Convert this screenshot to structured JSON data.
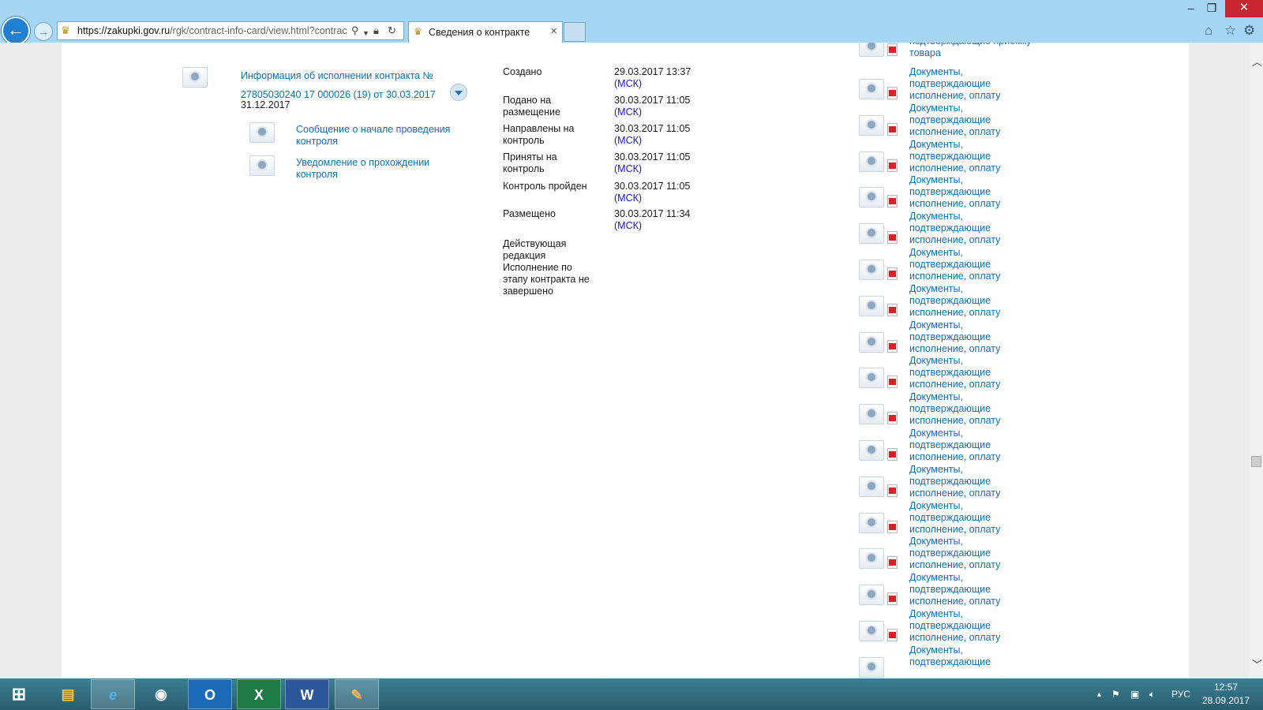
{
  "browser": {
    "url_host": "https://zakupki.gov.ru",
    "url_path": "/rgk/contract-info-card/view.html?contrac",
    "tab_title": "Сведения о контракте",
    "tab_close": "×",
    "window_controls": {
      "minimize": "–",
      "restore": "❐",
      "close": "✕"
    },
    "toolbar_icons": [
      "home-icon",
      "favorites-star-icon",
      "settings-gear-icon"
    ]
  },
  "contract": {
    "info_link": "Информация об исполнении контракта № 27805030240 17 000026 (19) от 30.03.2017",
    "info_date": "31.12.2017",
    "sub_docs": [
      {
        "label": "Сообщение о начале проведения контроля"
      },
      {
        "label": "Уведомление о прохождении контроля"
      }
    ]
  },
  "status": [
    {
      "label": "Создано",
      "datetime": "29.03.2017 13:37",
      "tz": "(МСК)"
    },
    {
      "label": "Подано на размещение",
      "datetime": "30.03.2017 11:05",
      "tz": "(МСК)"
    },
    {
      "label": "Направлены на контроль",
      "datetime": "30.03.2017 11:05",
      "tz": "(МСК)"
    },
    {
      "label": "Приняты на контроль",
      "datetime": "30.03.2017 11:05",
      "tz": "(МСК)"
    },
    {
      "label": "Контроль пройден",
      "datetime": "30.03.2017 11:05",
      "tz": "(МСК)"
    },
    {
      "label": "Размещено",
      "datetime": "30.03.2017 11:34",
      "tz": "(МСК)"
    }
  ],
  "status_note": "Действующая редакция Исполнение по этапу контракта не завершено",
  "documents": {
    "partial_top": "подтверждающие приемку товара",
    "repeated_label": "Документы, подтверждающие исполнение, оплату",
    "partial_bottom": "Документы, подтверждающие"
  },
  "taskbar": {
    "apps": [
      "File Explorer",
      "Internet Explorer",
      "Chrome",
      "Outlook",
      "Excel",
      "Word",
      "Paint"
    ],
    "language": "РУС",
    "time": "12:57",
    "date": "28.09.2017"
  },
  "colors": {
    "link": "#0e6fb8",
    "timezone": "#1515c8",
    "check": "#4f9a2c",
    "chrome": "#a6d6f5"
  }
}
